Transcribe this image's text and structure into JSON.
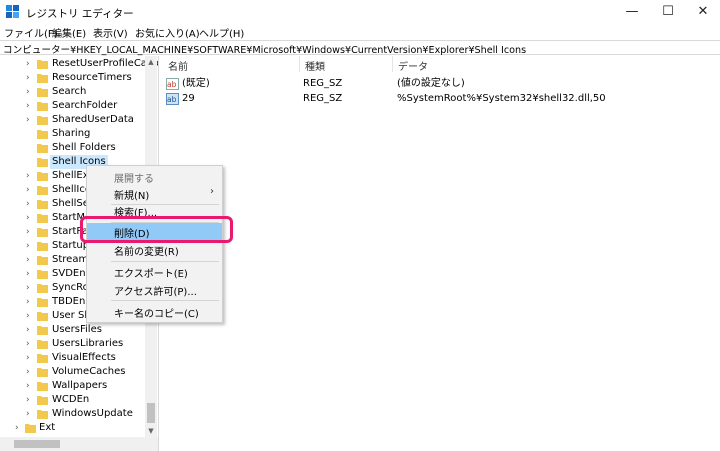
{
  "window": {
    "title": "レジストリ エディター",
    "minimize_glyph": "—",
    "maximize_glyph": "☐",
    "close_glyph": "✕"
  },
  "menubar": {
    "items": [
      "ファイル(F)",
      "編集(E)",
      "表示(V)",
      "お気に入り(A)",
      "ヘルプ(H)"
    ]
  },
  "address": {
    "path": "コンピューター¥HKEY_LOCAL_MACHINE¥SOFTWARE¥Microsoft¥Windows¥CurrentVersion¥Explorer¥Shell Icons"
  },
  "tree": {
    "items": [
      "ResetUserProfileCallba",
      "ResourceTimers",
      "Search",
      "SearchFolder",
      "SharedUserData",
      "Sharing",
      "Shell Folders",
      "Shell Icons",
      "ShellExec",
      "ShellIcon",
      "ShellServ",
      "StartMe",
      "StartPa",
      "Startup",
      "Streams",
      "SVDEn",
      "SyncRoo",
      "TBDEn",
      "User She",
      "UsersFiles",
      "UsersLibraries",
      "VisualEffects",
      "VolumeCaches",
      "Wallpapers",
      "WCDEn",
      "WindowsUpdate"
    ],
    "root_item": "Ext",
    "selected_index": 7
  },
  "list": {
    "headers": {
      "name": "名前",
      "type": "種類",
      "data": "データ"
    },
    "rows": [
      {
        "icon": "ab-string-icon",
        "name": "(既定)",
        "type": "REG_SZ",
        "data": "(値の設定なし)"
      },
      {
        "icon": "ab-string-icon",
        "name": "29",
        "type": "REG_SZ",
        "data": "%SystemRoot%¥System32¥shell32.dll,50"
      }
    ]
  },
  "context_menu": {
    "expand": "展開する",
    "new": "新規(N)",
    "find": "検索(F)...",
    "delete": "削除(D)",
    "rename": "名前の変更(R)",
    "export": "エクスポート(E)",
    "permissions": "アクセス許可(P)...",
    "copy_key_name": "キー名のコピー(C)",
    "submenu_glyph": "›"
  },
  "colors": {
    "selection": "#cce8ff",
    "menu_highlight": "#91c9f7",
    "callout_border": "#e8196e",
    "folder": "#f2c94c"
  }
}
